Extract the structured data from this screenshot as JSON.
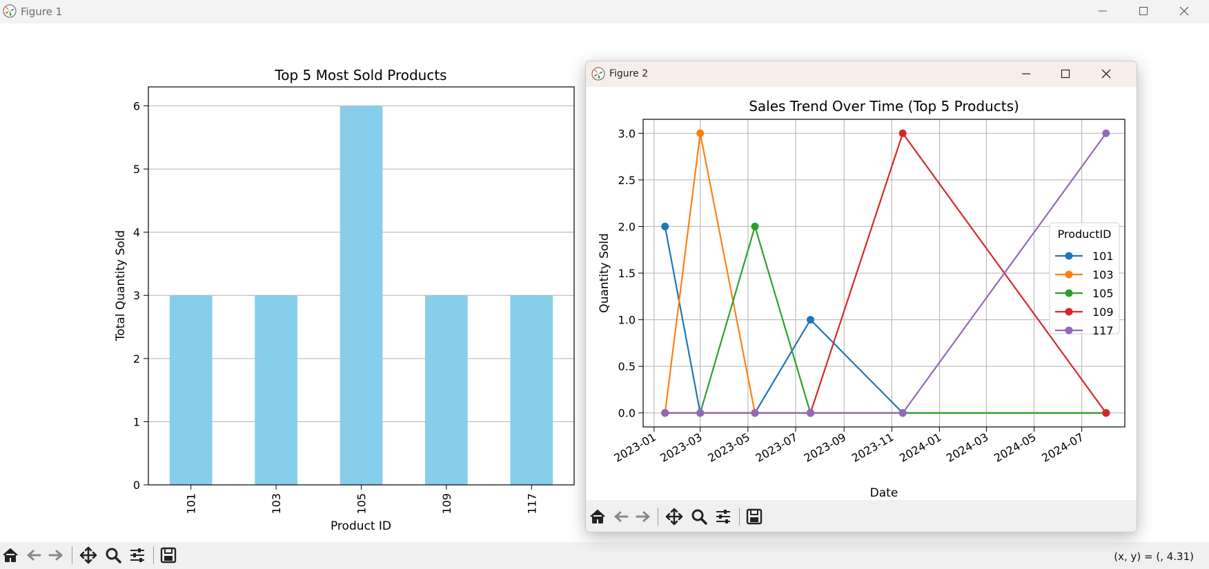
{
  "window1": {
    "title": "Figure 1",
    "coords_readout": "(x, y) = (, 4.31)"
  },
  "window2": {
    "title": "Figure 2"
  },
  "toolbar": {
    "icons": [
      "home-icon",
      "back-arrow-icon",
      "forward-arrow-icon",
      "pan-move-icon",
      "zoom-magnifier-icon",
      "configure-subplots-icon",
      "save-floppy-icon"
    ]
  },
  "colors": {
    "bar": "#87ceeb",
    "series": [
      "#1f77b4",
      "#ff7f0e",
      "#2ca02c",
      "#d62728",
      "#9467bd"
    ]
  },
  "chart_data": [
    {
      "type": "bar",
      "title": "Top 5 Most Sold Products",
      "xlabel": "Product ID",
      "ylabel": "Total Quantity Sold",
      "categories": [
        "101",
        "103",
        "105",
        "109",
        "117"
      ],
      "values": [
        3,
        3,
        6,
        3,
        3
      ],
      "ylim": [
        0,
        6.3
      ],
      "yticks": [
        "0",
        "1",
        "2",
        "3",
        "4",
        "5",
        "6"
      ],
      "grid": "horizontal"
    },
    {
      "type": "line",
      "title": "Sales Trend Over Time (Top 5 Products)",
      "xlabel": "Date",
      "ylabel": "Quantity Sold",
      "x": [
        "2023-01-15",
        "2023-03-01",
        "2023-05-10",
        "2023-07-20",
        "2023-11-15",
        "2024-08-01"
      ],
      "xticks": [
        "2023-01",
        "2023-03",
        "2023-05",
        "2023-07",
        "2023-09",
        "2023-11",
        "2024-01",
        "2024-03",
        "2024-05",
        "2024-07"
      ],
      "yticks": [
        "0.0",
        "0.5",
        "1.0",
        "1.5",
        "2.0",
        "2.5",
        "3.0"
      ],
      "ylim": [
        -0.15,
        3.15
      ],
      "legend_title": "ProductID",
      "legend_position": "center-right",
      "grid": true,
      "series": [
        {
          "name": "101",
          "values": [
            2,
            0,
            0,
            1,
            0,
            0
          ]
        },
        {
          "name": "103",
          "values": [
            0,
            3,
            0,
            0,
            0,
            0
          ]
        },
        {
          "name": "105",
          "values": [
            0,
            0,
            2,
            0,
            0,
            0
          ]
        },
        {
          "name": "109",
          "values": [
            0,
            0,
            0,
            0,
            3,
            0
          ]
        },
        {
          "name": "117",
          "values": [
            0,
            0,
            0,
            0,
            0,
            3
          ]
        }
      ]
    }
  ]
}
